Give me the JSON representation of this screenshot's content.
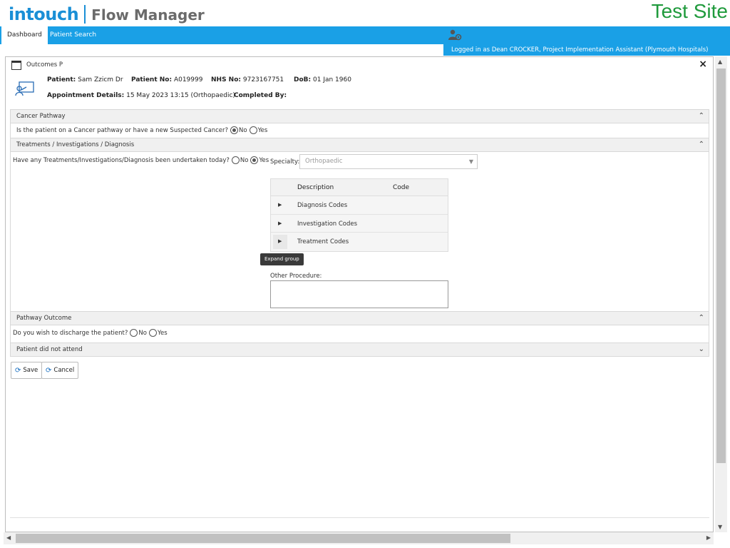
{
  "header": {
    "logo_primary": "intouch",
    "logo_secondary": "Flow Manager",
    "site_label": "Test Site",
    "brand_color": "#1a8fd6",
    "site_color": "#1f9a3c"
  },
  "nav": {
    "tabs": [
      {
        "label": "Dashboard",
        "active": true
      },
      {
        "label": "Patient Search",
        "active": false
      }
    ],
    "user_icon": "user-gear-icon",
    "logged_in_text": "Logged in as Dean CROCKER, Project Implementation Assistant (Plymouth Hospitals)",
    "bar_color": "#1aa0e6"
  },
  "dialog": {
    "title": "Outcomes P",
    "title_icon": "window-icon",
    "close_label": "×",
    "patient": {
      "icon": "patient-presentation-icon",
      "name_label": "Patient:",
      "name_value": "Sam Zzicm Dr",
      "patient_no_label": "Patient No:",
      "patient_no_value": "A019999",
      "nhs_label": "NHS No:",
      "nhs_value": "9723167751",
      "dob_label": "DoB:",
      "dob_value": "01 Jan 1960",
      "appt_label": "Appointment Details:",
      "appt_value": "15 May 2023 13:15 (Orthopaedic)",
      "completed_label": "Completed By:",
      "completed_value": ""
    },
    "sections": {
      "cancer": {
        "title": "Cancer Pathway",
        "chevron": "chevron-up-icon",
        "question": "Is the patient on a Cancer pathway or have a new Suspected Cancer?",
        "options": [
          "No",
          "Yes"
        ],
        "selected": "No"
      },
      "treatments": {
        "title": "Treatments / Investigations / Diagnosis",
        "chevron": "chevron-up-icon",
        "question": "Have any Treatments/Investigations/Diagnosis been undertaken today?",
        "options": [
          "No",
          "Yes"
        ],
        "selected": "Yes",
        "specialty_label": "Specialty:",
        "specialty_value": "Orthopaedic",
        "table": {
          "columns": [
            "Description",
            "Code"
          ],
          "rows": [
            "Diagnosis Codes",
            "Investigation Codes",
            "Treatment Codes"
          ]
        },
        "tooltip": "Expand group",
        "other_label": "Other Procedure:",
        "other_value": ""
      },
      "pathway": {
        "title": "Pathway Outcome",
        "chevron": "chevron-up-icon",
        "question": "Do you wish to discharge the patient?",
        "options": [
          "No",
          "Yes"
        ],
        "selected": ""
      },
      "dna": {
        "title": "Patient did not attend",
        "chevron": "chevron-down-icon"
      }
    },
    "buttons": {
      "save": "Save",
      "cancel": "Cancel",
      "icon": "refresh-icon"
    }
  }
}
